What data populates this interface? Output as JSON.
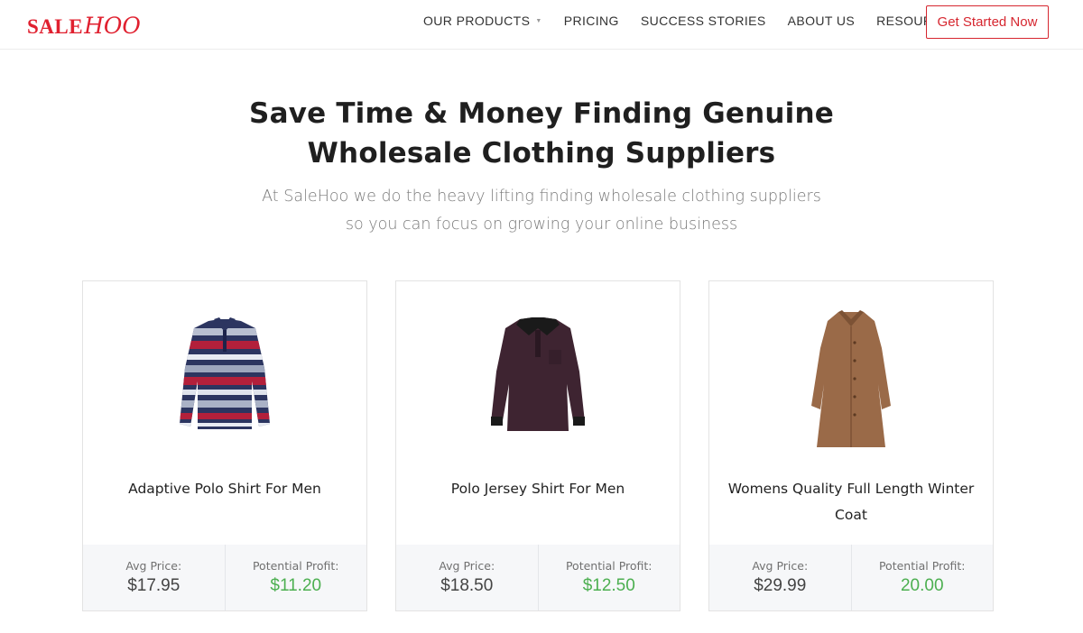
{
  "brand": {
    "logo_sale": "SALE",
    "logo_hoo": "HOO",
    "color": "#e0202f"
  },
  "nav": {
    "items": [
      {
        "label": "OUR PRODUCTS",
        "dropdown": true
      },
      {
        "label": "PRICING",
        "dropdown": false
      },
      {
        "label": "SUCCESS STORIES",
        "dropdown": false
      },
      {
        "label": "ABOUT US",
        "dropdown": false
      },
      {
        "label": "RESOURCES",
        "dropdown": true
      }
    ],
    "cta_label": "Get Started Now"
  },
  "hero": {
    "title_line1": "Save Time & Money Finding Genuine",
    "title_line2": "Wholesale Clothing Suppliers",
    "subtitle_line1": "At SaleHoo we do the heavy lifting finding wholesale clothing suppliers",
    "subtitle_line2": "so you can focus on growing your online business"
  },
  "products": [
    {
      "title": "Adaptive Polo Shirt For Men",
      "image_icon": "striped-polo-shirt-icon",
      "avg_price_label": "Avg Price:",
      "avg_price": "$17.95",
      "profit_label": "Potential Profit:",
      "profit": "$11.20"
    },
    {
      "title": "Polo Jersey Shirt For Men",
      "image_icon": "jersey-polo-shirt-icon",
      "avg_price_label": "Avg Price:",
      "avg_price": "$18.50",
      "profit_label": "Potential Profit:",
      "profit": "$12.50"
    },
    {
      "title": "Womens Quality Full Length Winter Coat",
      "image_icon": "winter-coat-icon",
      "avg_price_label": "Avg Price:",
      "avg_price": "$29.99",
      "profit_label": "Potential Profit:",
      "profit": "20.00"
    }
  ],
  "colors": {
    "accent_red": "#d6262f",
    "profit_green": "#4caf50"
  }
}
